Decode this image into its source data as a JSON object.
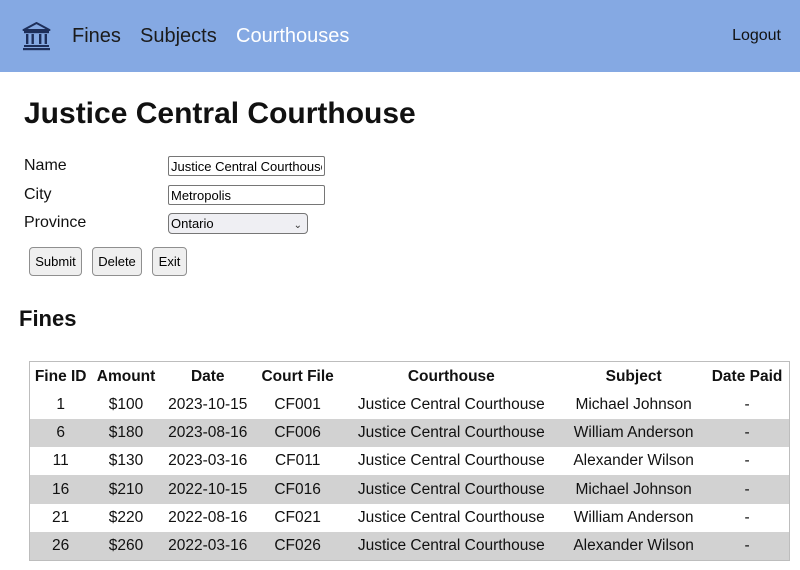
{
  "nav": {
    "logo_icon": "courthouse-icon",
    "links": [
      "Fines",
      "Subjects",
      "Courthouses"
    ],
    "active": "Courthouses",
    "logout_label": "Logout"
  },
  "page": {
    "title": "Justice Central Courthouse"
  },
  "form": {
    "name_label": "Name",
    "name_value": "Justice Central Courthouse",
    "city_label": "City",
    "city_value": "Metropolis",
    "province_label": "Province",
    "province_value": "Ontario",
    "buttons": {
      "submit": "Submit",
      "delete": "Delete",
      "exit": "Exit"
    }
  },
  "fines": {
    "title": "Fines",
    "columns": [
      "Fine ID",
      "Amount",
      "Date",
      "Court File",
      "Courthouse",
      "Subject",
      "Date Paid"
    ],
    "rows": [
      [
        "1",
        "$100",
        "2023-10-15",
        "CF001",
        "Justice Central Courthouse",
        "Michael Johnson",
        "-"
      ],
      [
        "6",
        "$180",
        "2023-08-16",
        "CF006",
        "Justice Central Courthouse",
        "William Anderson",
        "-"
      ],
      [
        "11",
        "$130",
        "2023-03-16",
        "CF011",
        "Justice Central Courthouse",
        "Alexander Wilson",
        "-"
      ],
      [
        "16",
        "$210",
        "2022-10-15",
        "CF016",
        "Justice Central Courthouse",
        "Michael Johnson",
        "-"
      ],
      [
        "21",
        "$220",
        "2022-08-16",
        "CF021",
        "Justice Central Courthouse",
        "William Anderson",
        "-"
      ],
      [
        "26",
        "$260",
        "2022-03-16",
        "CF026",
        "Justice Central Courthouse",
        "Alexander Wilson",
        "-"
      ]
    ]
  },
  "colors": {
    "navbar_bg": "#85a9e3",
    "nav_active": "#ffffff",
    "row_alt_bg": "#d2d2d2"
  }
}
